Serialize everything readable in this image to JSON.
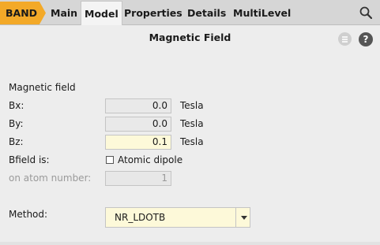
{
  "tabs": {
    "band": "BAND",
    "items": [
      "Main",
      "Model",
      "Properties",
      "Details",
      "MultiLevel"
    ],
    "active": "Model"
  },
  "icons": {
    "search": "search-icon",
    "menu": "menu-icon",
    "help": "help-icon"
  },
  "panel": {
    "title": "Magnetic Field",
    "help_glyph": "?"
  },
  "magnetic": {
    "section_label": "Magnetic field",
    "bx": {
      "label": "Bx:",
      "value": "0.0",
      "unit": "Tesla"
    },
    "by": {
      "label": "By:",
      "value": "0.0",
      "unit": "Tesla"
    },
    "bz": {
      "label": "Bz:",
      "value": "0.1",
      "unit": "Tesla"
    },
    "bfield": {
      "label": "Bfield is:",
      "checkbox_label": "Atomic dipole",
      "checked": false
    },
    "atom": {
      "label": "on atom number:",
      "value": "1",
      "disabled": true
    }
  },
  "method": {
    "label": "Method:",
    "selected": "NR_LDOTB"
  },
  "colors": {
    "accent": "#f3a928",
    "highlight_field": "#fdf9d9"
  }
}
